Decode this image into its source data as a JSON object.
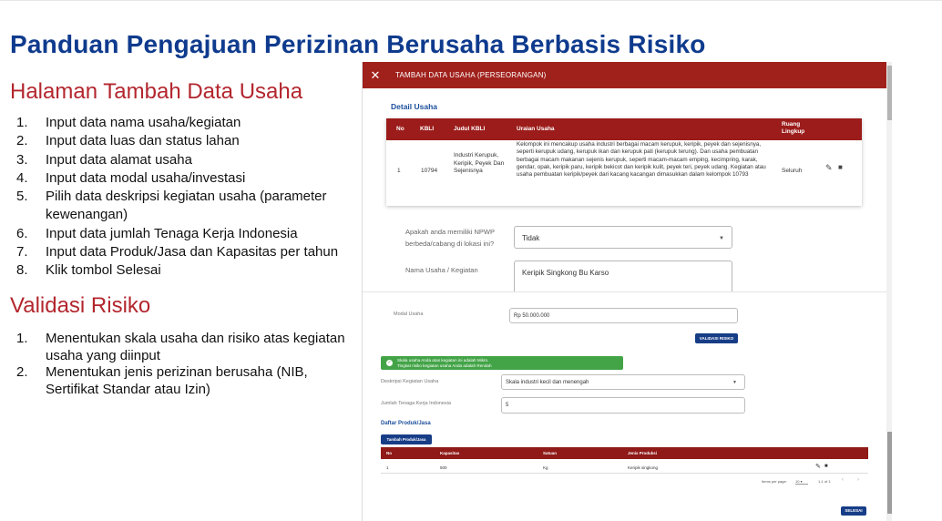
{
  "title": "Panduan Pengajuan Perizinan Berusaha Berbasis Risiko",
  "section1": {
    "heading": "Halaman Tambah Data Usaha",
    "steps": [
      {
        "n": "1.",
        "text": "Input data nama usaha/kegiatan"
      },
      {
        "n": "2.",
        "text": "Input data luas dan status lahan"
      },
      {
        "n": "3.",
        "text": "Input data alamat usaha"
      },
      {
        "n": "4.",
        "text": "Input data modal usaha/investasi"
      },
      {
        "n": "5.",
        "text": "Pilih data deskripsi kegiatan usaha (parameter kewenangan)"
      },
      {
        "n": "6.",
        "text": "Input data jumlah Tenaga Kerja Indonesia"
      },
      {
        "n": "7.",
        "text": "Input data Produk/Jasa dan Kapasitas per tahun"
      },
      {
        "n": "8.",
        "text": "Klik tombol Selesai"
      }
    ]
  },
  "section2": {
    "heading": "Validasi Risiko",
    "steps": [
      {
        "n": "1.",
        "text": "Menentukan skala usaha dan risiko atas kegiatan usaha yang diinput"
      },
      {
        "n": "2.",
        "text": "Menentukan jenis perizinan berusaha (NIB, Sertifikat Standar atau Izin)"
      }
    ]
  },
  "dialog": {
    "close_icon": "close-icon",
    "title": "TAMBAH DATA USAHA (PERSEORANGAN)",
    "detail_title": "Detail Usaha",
    "kbli_headers": {
      "no": "No",
      "kbli": "KBLI",
      "judul": "Judul KBLI",
      "uraian": "Uraian Usaha",
      "ruang": "Ruang Lingkup"
    },
    "kbli_row": {
      "no": "1",
      "kbli": "10794",
      "judul": "Industri Kerupuk, Keripik, Peyek Dan Sejenisnya",
      "uraian": "Kelompok ini mencakup usaha industri berbagai macam kerupuk, keripik, peyek dan sejenisnya, seperti kerupuk udang, kerupuk ikan dan kerupuk pati (kerupuk terung). Dan usaha pembuatan berbagai macam makanan sejenis kerupuk, seperti macam-macam emping, kecimpring, karak, gendar, opak, keripik paru, keripik bekicot dan keripik kulit, peyek teri, peyek udang. Kegiatan atau usaha pembuatan keripik/peyek dari kacang kacangan dimasukkan dalam kelompok 10793",
      "ruang": "Seluruh"
    },
    "npwp_label": "Apakah anda memiliki NPWP berbeda/cabang di lokasi ini?",
    "npwp_value": "Tidak",
    "nama_label": "Nama Usaha / Kegiatan",
    "nama_value": "Keripik Singkong Bu Karso",
    "modal_label": "Modal Usaha",
    "modal_value": "Rp 50.000.000",
    "validasi_button": "VALIDASI RISIKO",
    "alert_line1": "Skala usaha Anda atas kegiatan ini adalah Mikro.",
    "alert_line2": "Tingkat risiko kegiatan usaha Anda adalah Rendah",
    "deskripsi_label": "Deskripsi Kegiatan Usaha",
    "deskripsi_value": "Skala industri kecil dan menengah",
    "tki_label": "Jumlah Tenaga Kerja Indonesia",
    "tki_value": "5",
    "produk_title": "Daftar Produk/Jasa",
    "tambah_button": "Tambah Produk/Jasa",
    "produk_headers": {
      "no": "No",
      "kapasitas": "Kapasitas",
      "satuan": "Satuan",
      "jenis": "Jenis Produksi"
    },
    "produk_row": {
      "no": "1",
      "kapasitas": "500",
      "satuan": "Kg",
      "jenis": "Keripik singkong"
    },
    "pagination": {
      "label": "Items per page:",
      "per_page": "10",
      "range": "1-1 of 1"
    },
    "selesai_button": "SELESAI"
  }
}
